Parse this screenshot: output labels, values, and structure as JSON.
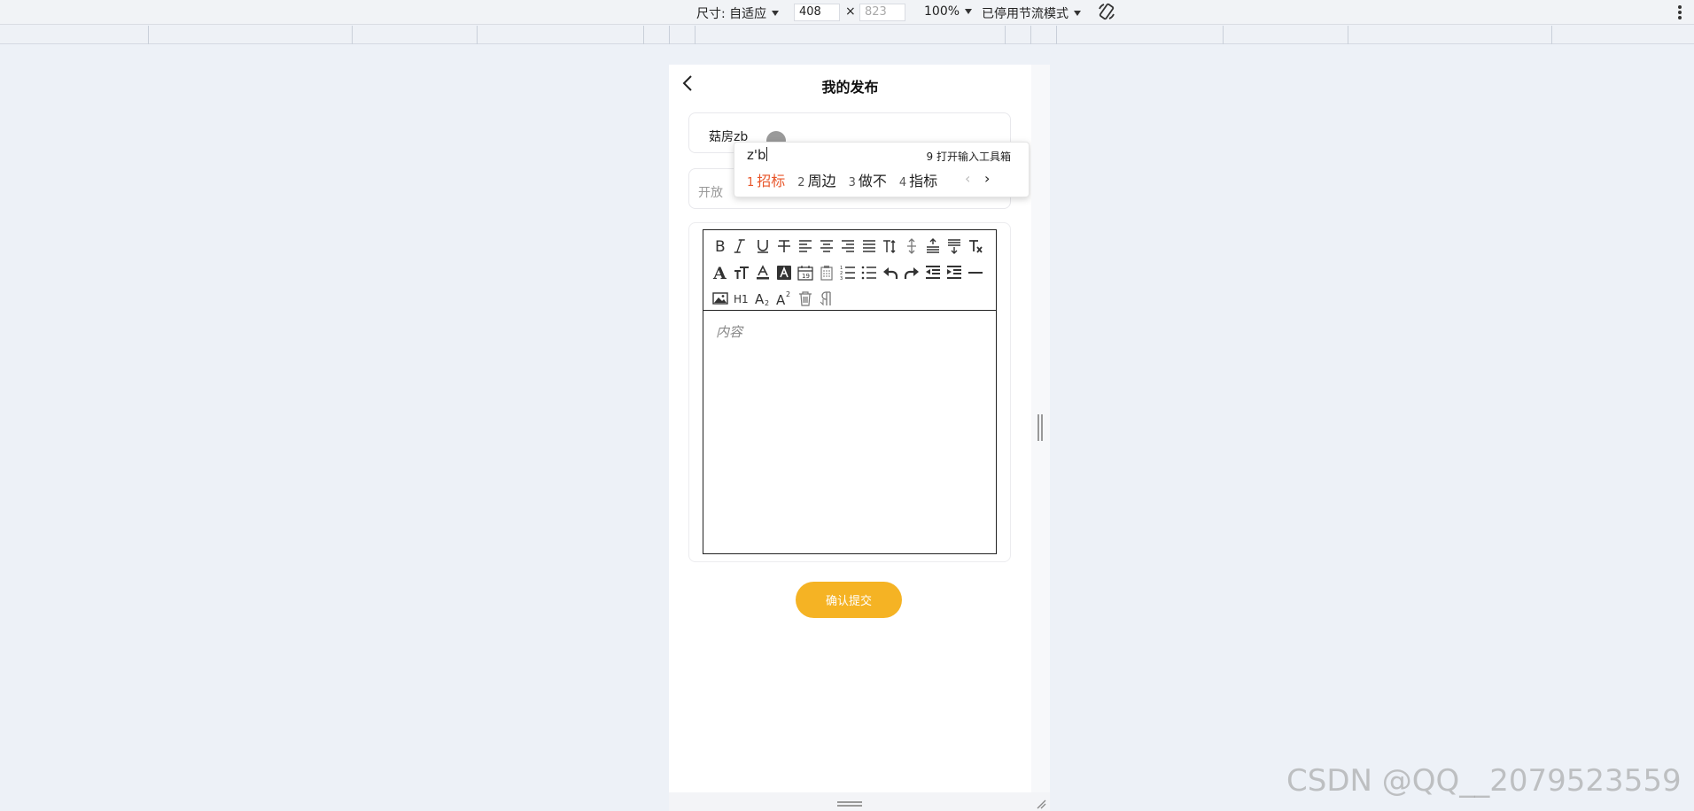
{
  "devtools": {
    "dimensions_label": "尺寸: 自适应",
    "width_value": "408",
    "times_sign": "×",
    "height_placeholder": "823",
    "zoom_label": "100%",
    "throttle_label": "已停用节流模式"
  },
  "page": {
    "title": "我的发布",
    "title_input_value": "菇房zb",
    "select_value": "开放",
    "editor_placeholder": "内容",
    "submit_label": "确认提交"
  },
  "ime": {
    "composition": "z'b",
    "toolbox_hint": "9 打开输入工具箱",
    "candidates": [
      {
        "num": "1",
        "text": "招标"
      },
      {
        "num": "2",
        "text": "周边"
      },
      {
        "num": "3",
        "text": "做不"
      },
      {
        "num": "4",
        "text": "指标"
      }
    ],
    "prev_glyph": "‹",
    "next_glyph": "›"
  },
  "toolbar_icons": [
    "bold-icon",
    "italic-icon",
    "underline-icon",
    "strikethrough-icon",
    "align-left-icon",
    "align-center-icon",
    "align-right-icon",
    "align-justify-icon",
    "font-size-icon",
    "line-height-icon",
    "paragraph-space-before-icon",
    "paragraph-space-after-icon",
    "remove-format-icon",
    "font-family-icon",
    "text-size-icon",
    "font-color-icon",
    "background-color-icon",
    "insert-date-icon",
    "clipboard-icon",
    "ordered-list-icon",
    "unordered-list-icon",
    "undo-icon",
    "redo-icon",
    "outdent-icon",
    "indent-icon",
    "horizontal-rule-icon",
    "insert-image-icon",
    "heading-icon",
    "subscript-icon",
    "superscript-icon",
    "delete-icon",
    "paragraph-mark-icon"
  ],
  "colors": {
    "submit_button": "#f5b324",
    "ime_active": "#e8562a"
  },
  "watermark": "CSDN @QQ__2079523559"
}
